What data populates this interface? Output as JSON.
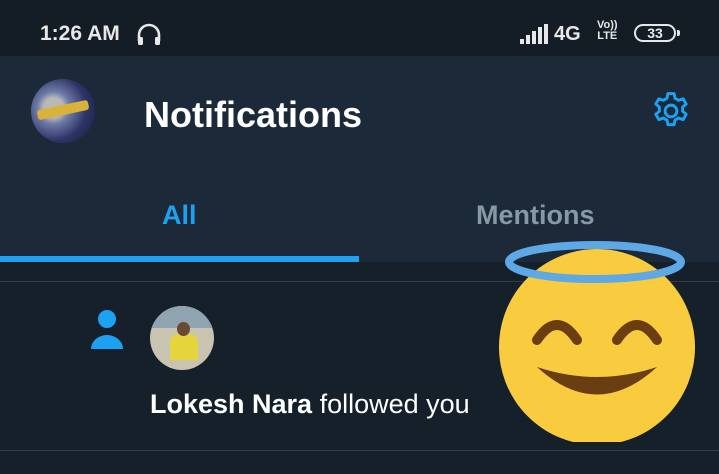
{
  "status_bar": {
    "time": "1:26 AM",
    "network": "4G",
    "volte_top": "Vo))",
    "volte_bottom": "LTE",
    "battery": "33",
    "icons": [
      "headset-icon",
      "signal-icon"
    ]
  },
  "header": {
    "title": "Notifications",
    "settings_icon": "gear-icon",
    "accent": "#1da1f2"
  },
  "tabs": [
    {
      "label": "All",
      "active": true
    },
    {
      "label": "Mentions",
      "active": false
    }
  ],
  "notifications": [
    {
      "type_icon": "person-icon",
      "user": "Lokesh Nara",
      "action": " followed you"
    }
  ],
  "overlay": {
    "icon": "smiling-face-with-halo-emoji"
  }
}
